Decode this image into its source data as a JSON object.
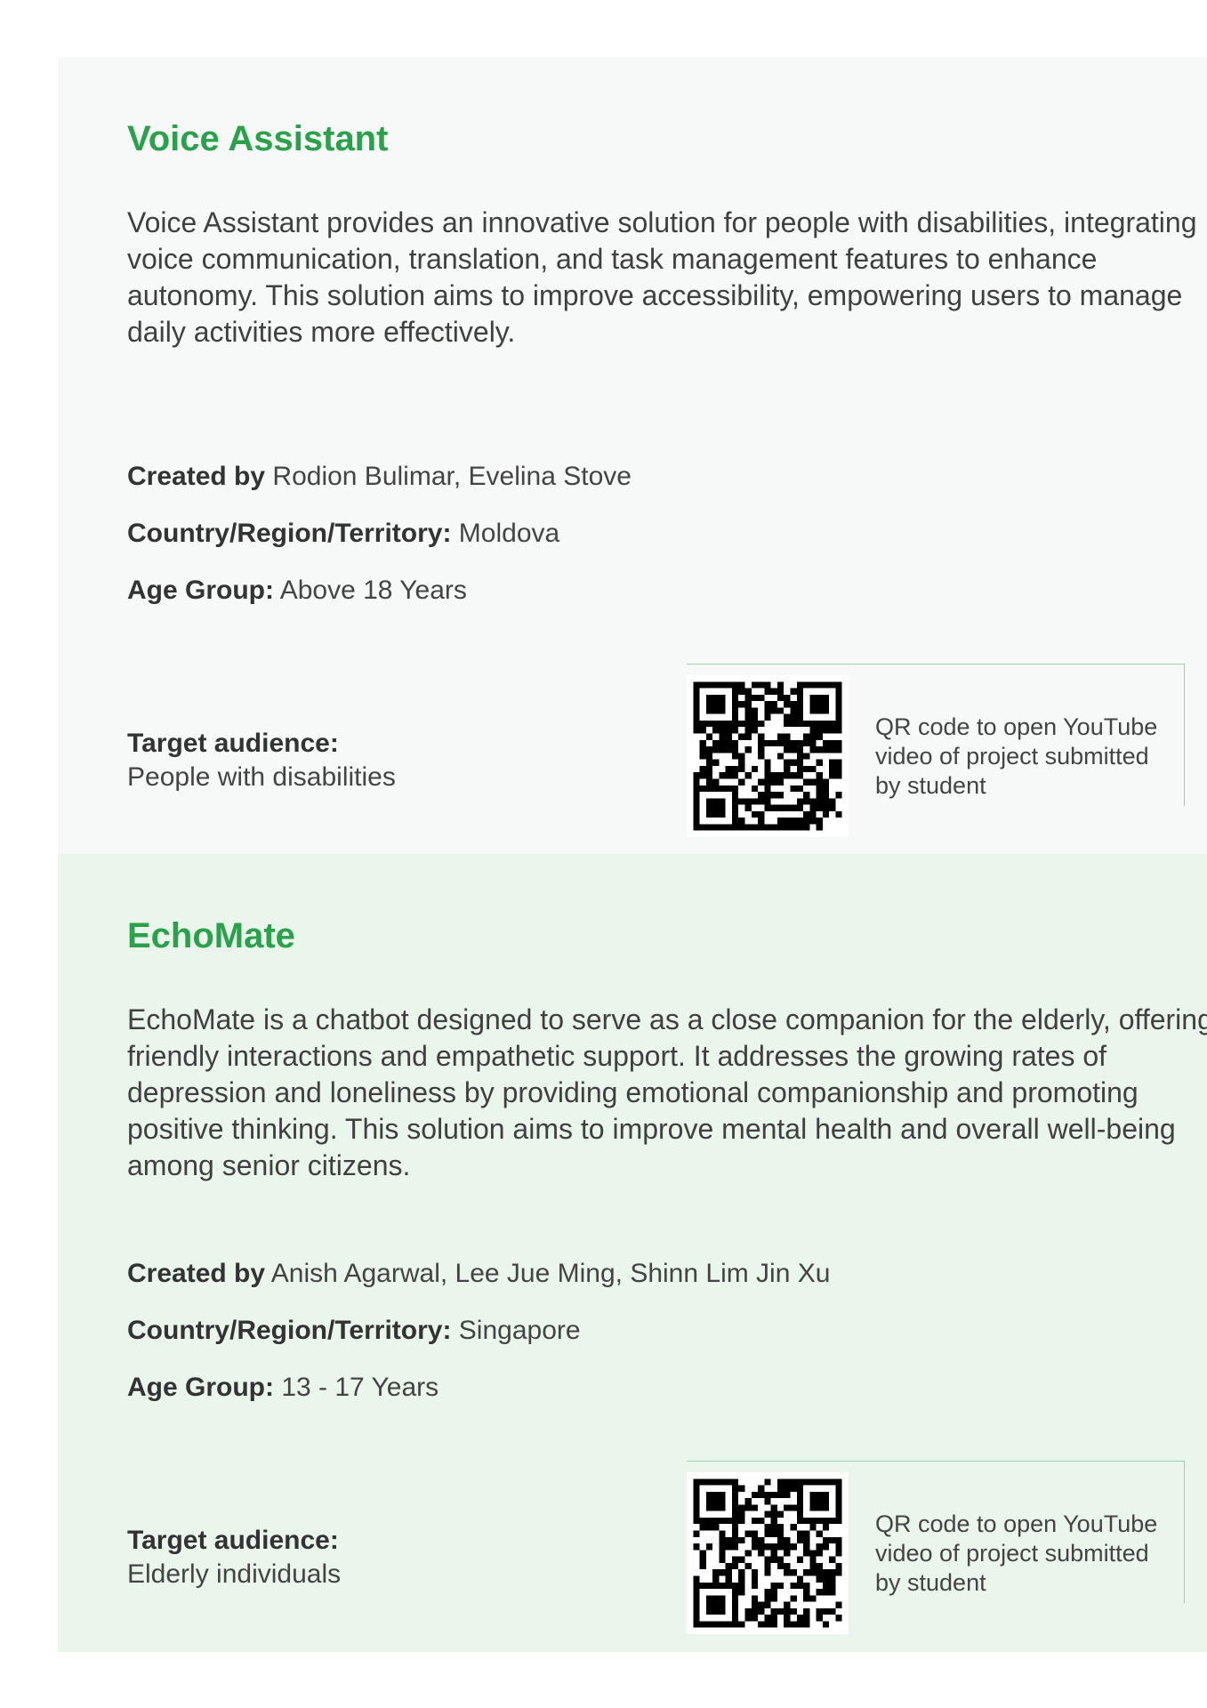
{
  "projects": [
    {
      "title": "Voice Assistant",
      "description": "Voice Assistant provides an innovative solution for people with disabilities, integrating voice communication, translation, and task management features to enhance autonomy. This solution aims to improve accessibility, empowering users to manage daily activities more effectively.",
      "created_by_label": "Created by",
      "created_by": "Rodion Bulimar, Evelina Stove",
      "country_label": "Country/Region/Territory:",
      "country": "Moldova",
      "age_label": "Age Group:",
      "age": "Above 18 Years",
      "audience_label": "Target audience:",
      "audience": "People with disabilities",
      "qr_text": "QR code to open YouTube video of project submitted by student"
    },
    {
      "title": "EchoMate",
      "description": "EchoMate is a chatbot designed to serve as a close companion for the elderly, offering friendly interactions and empathetic support. It addresses the growing rates of depression and loneliness by providing emotional companionship and promoting positive thinking. This solution aims to improve mental health and overall well-being among senior citizens.",
      "created_by_label": "Created by",
      "created_by": "Anish Agarwal, Lee Jue Ming, Shinn Lim Jin Xu",
      "country_label": "Country/Region/Territory:",
      "country": "Singapore",
      "age_label": "Age Group:",
      "age": "13 - 17 Years",
      "audience_label": "Target audience:",
      "audience": "Elderly individuals",
      "qr_text": "QR code to open YouTube video of project submitted by student"
    }
  ],
  "colors": {
    "accent": "#2aa14a",
    "card1_bg": "#f7f9f8",
    "card2_bg": "#eaf5ec",
    "qr_border": "#9bd3a6"
  }
}
